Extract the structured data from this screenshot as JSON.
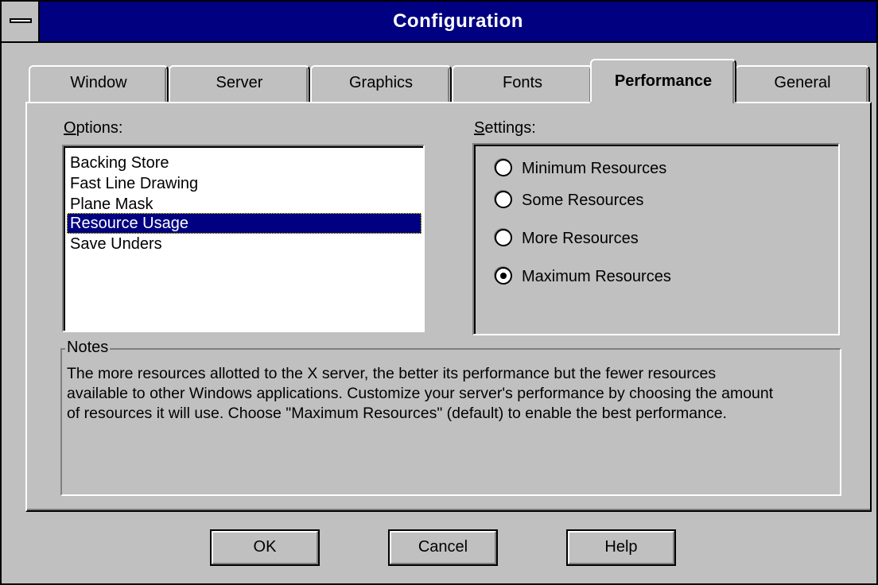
{
  "window": {
    "title": "Configuration",
    "system_menu_icon": "system-menu-icon"
  },
  "tabs": [
    {
      "label": "Window",
      "active": false
    },
    {
      "label": "Server",
      "active": false
    },
    {
      "label": "Graphics",
      "active": false
    },
    {
      "label": "Fonts",
      "active": false
    },
    {
      "label": "Performance",
      "active": true
    },
    {
      "label": "General",
      "active": false
    }
  ],
  "options": {
    "label_mnemonic": "O",
    "label_rest": "ptions:",
    "items": [
      {
        "label": "Backing Store",
        "selected": false
      },
      {
        "label": "Fast Line Drawing",
        "selected": false
      },
      {
        "label": "Plane Mask",
        "selected": false
      },
      {
        "label": "Resource Usage",
        "selected": true
      },
      {
        "label": "Save Unders",
        "selected": false
      }
    ]
  },
  "settings": {
    "label_mnemonic": "S",
    "label_rest": "ettings:",
    "radios": [
      {
        "label": "Minimum Resources",
        "checked": false
      },
      {
        "label": "Some Resources",
        "checked": false
      },
      {
        "label": "More Resources",
        "checked": false
      },
      {
        "label": "Maximum Resources",
        "checked": true
      }
    ]
  },
  "notes": {
    "legend": "Notes",
    "lines": [
      "The more resources allotted to the X server, the better its performance but the fewer resources",
      "available to other Windows applications. Customize your server's performance by choosing the amount",
      "of resources it will use. Choose \"Maximum Resources\" (default) to enable the best performance."
    ]
  },
  "buttons": {
    "ok": "OK",
    "cancel": "Cancel",
    "help": "Help"
  },
  "colors": {
    "face": "#c0c0c0",
    "titlebar": "#000080",
    "selection": "#000080"
  }
}
